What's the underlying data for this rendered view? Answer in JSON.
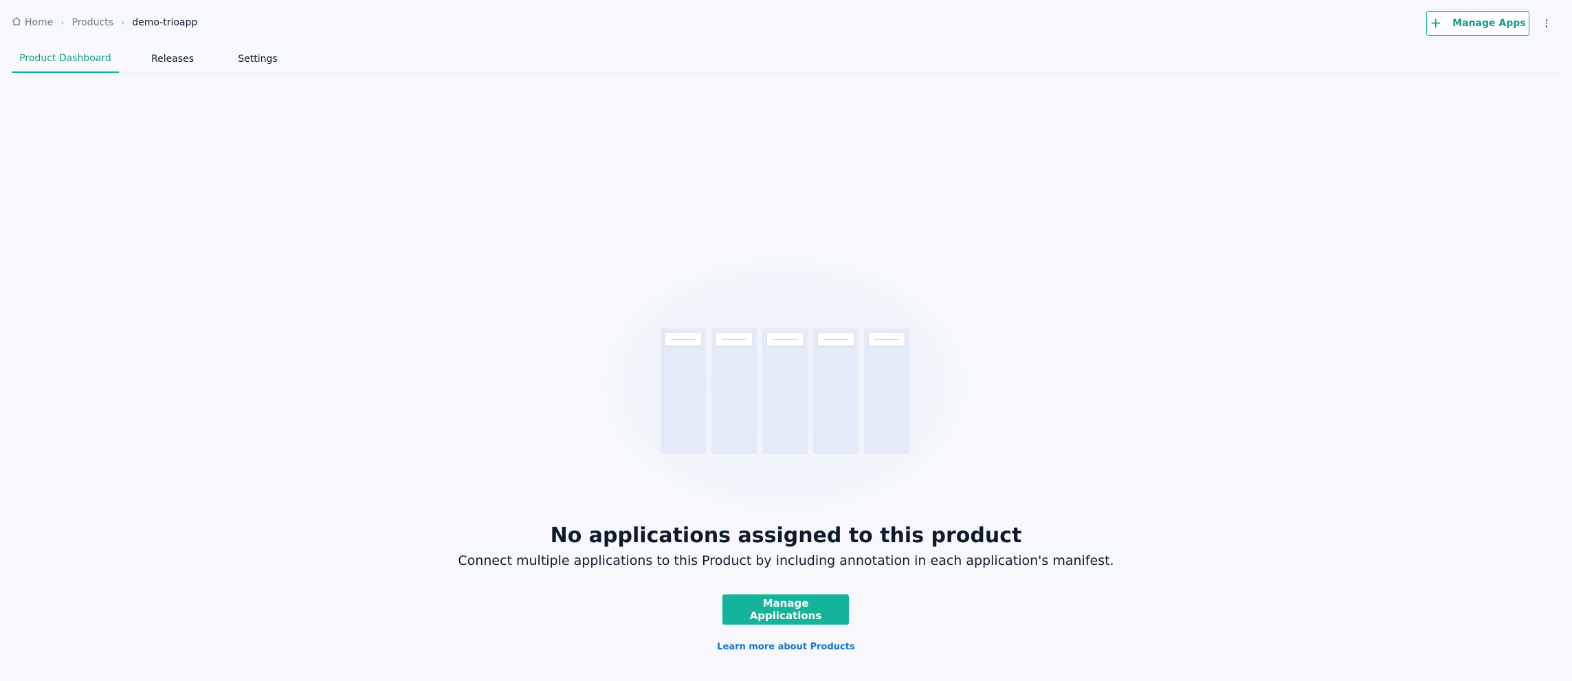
{
  "breadcrumb": {
    "items": [
      "Home",
      "Products",
      "demo-trioapp"
    ],
    "separator": "›"
  },
  "header": {
    "manage_apps_label": "Manage Apps",
    "manage_apps_icon": "plus-icon",
    "more_icon": "kebab-menu-icon"
  },
  "tabs": [
    {
      "label": "Product Dashboard",
      "active": true
    },
    {
      "label": "Releases",
      "active": false
    },
    {
      "label": "Settings",
      "active": false
    }
  ],
  "empty_state": {
    "title": "No applications assigned to this product",
    "subtitle": "Connect multiple applications to this Product by including annotation in each application's manifest.",
    "primary_button": "Manage Applications",
    "link": "Learn more about Products"
  },
  "colors": {
    "accent": "#14b39a",
    "link": "#1475c9",
    "background": "#f6f8fc"
  }
}
